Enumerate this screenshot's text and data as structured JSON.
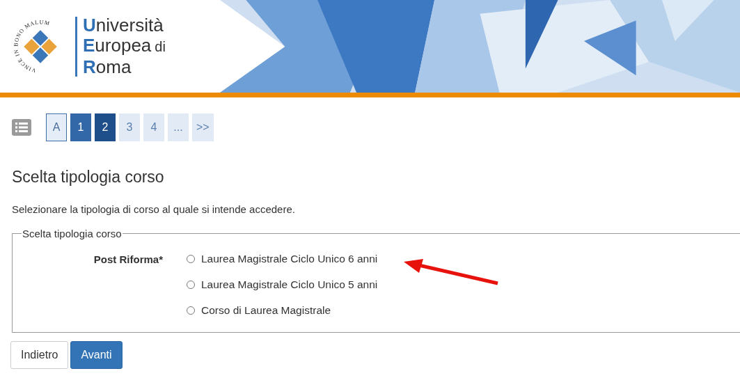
{
  "header": {
    "logo": {
      "motto": "VINCE IN BONO MALUM",
      "lines": [
        {
          "initial": "U",
          "rest": "niversità"
        },
        {
          "initial": "E",
          "rest": "uropea",
          "suffix": "di"
        },
        {
          "initial": "R",
          "rest": "oma"
        }
      ]
    }
  },
  "steps": [
    {
      "label": "A",
      "kind": "start",
      "selected": false
    },
    {
      "label": "1",
      "kind": "done",
      "selected": false
    },
    {
      "label": "2",
      "kind": "done",
      "selected": true
    },
    {
      "label": "3",
      "kind": "todo",
      "selected": false
    },
    {
      "label": "4",
      "kind": "todo",
      "selected": false
    },
    {
      "label": "...",
      "kind": "todo",
      "selected": false
    },
    {
      "label": ">>",
      "kind": "todo",
      "selected": false
    }
  ],
  "title": "Scelta tipologia corso",
  "description": "Selezionare la tipologia di corso al quale si intende accedere.",
  "fieldset": {
    "legend": "Scelta tipologia corso",
    "label": "Post Riforma*",
    "options": [
      {
        "label": "Laurea Magistrale Ciclo Unico 6 anni",
        "selected": false
      },
      {
        "label": "Laurea Magistrale Ciclo Unico 5 anni",
        "selected": false
      },
      {
        "label": "Corso di Laurea Magistrale",
        "selected": false
      }
    ]
  },
  "buttons": [
    {
      "label": "Indietro",
      "kind": "secondary"
    },
    {
      "label": "Avanti",
      "kind": "primary"
    }
  ]
}
